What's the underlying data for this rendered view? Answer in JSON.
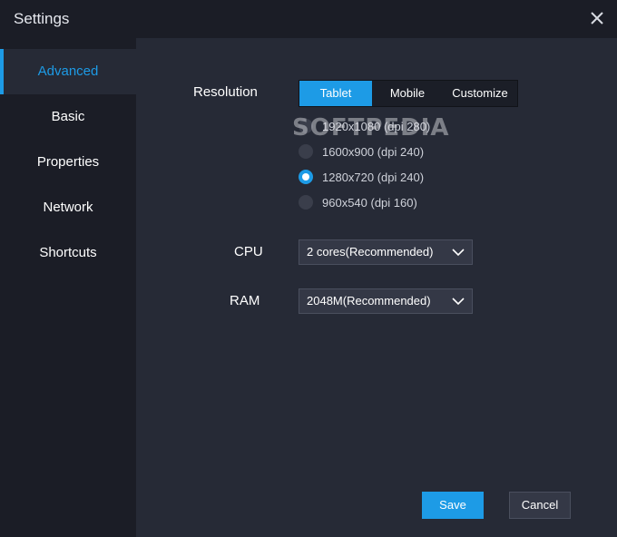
{
  "window": {
    "title": "Settings"
  },
  "sidebar": {
    "items": [
      {
        "label": "Advanced",
        "active": true
      },
      {
        "label": "Basic"
      },
      {
        "label": "Properties"
      },
      {
        "label": "Network"
      },
      {
        "label": "Shortcuts"
      }
    ]
  },
  "resolution": {
    "label": "Resolution",
    "tabs": [
      {
        "label": "Tablet",
        "active": true
      },
      {
        "label": "Mobile"
      },
      {
        "label": "Customize"
      }
    ],
    "options": [
      {
        "label": "1920x1080  (dpi 280)"
      },
      {
        "label": "1600x900  (dpi 240)"
      },
      {
        "label": "1280x720  (dpi 240)",
        "selected": true
      },
      {
        "label": "960x540  (dpi 160)"
      }
    ]
  },
  "watermark": "SOFTPEDIA",
  "cpu": {
    "label": "CPU",
    "value": "2 cores(Recommended)"
  },
  "ram": {
    "label": "RAM",
    "value": "2048M(Recommended)"
  },
  "buttons": {
    "save": "Save",
    "cancel": "Cancel"
  },
  "colors": {
    "accent": "#1d9be6",
    "panel": "#262a36",
    "background": "#1b1d26"
  }
}
